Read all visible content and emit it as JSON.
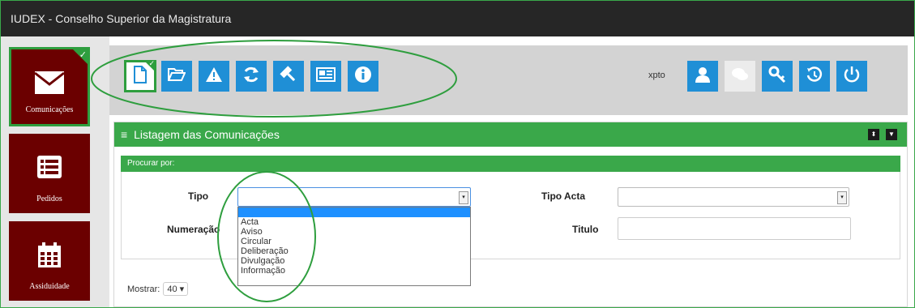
{
  "app": {
    "title": "IUDEX - Conselho Superior da Magistratura"
  },
  "sidebar": {
    "items": [
      {
        "label": "Comunicações",
        "icon": "envelope-icon",
        "active": true
      },
      {
        "label": "Pedidos",
        "icon": "list-icon",
        "active": false
      },
      {
        "label": "Assiduidade",
        "icon": "calendar-icon",
        "active": false
      }
    ]
  },
  "toolbar": {
    "left_buttons": [
      "new-document-icon",
      "folder-open-icon",
      "warning-icon",
      "refresh-icon",
      "gavel-icon",
      "newspaper-icon",
      "info-icon"
    ],
    "user": "xpto",
    "right_buttons": [
      "user-icon",
      "comments-icon",
      "key-icon",
      "history-icon",
      "power-icon"
    ]
  },
  "panel": {
    "title": "Listagem das Comunicações",
    "menu_glyph": "≡",
    "search": {
      "header": "Procurar por:",
      "fields": {
        "tipo": {
          "label": "Tipo",
          "value": ""
        },
        "tipo_acta": {
          "label": "Tipo Acta",
          "value": ""
        },
        "numeracao": {
          "label": "Numeração",
          "value": ""
        },
        "titulo": {
          "label": "Titulo",
          "value": ""
        }
      },
      "tipo_options": [
        "Acta",
        "Aviso",
        "Circular",
        "Deliberação",
        "Divulgação",
        "Informação"
      ]
    },
    "show": {
      "label": "Mostrar:",
      "value": "40"
    }
  },
  "colors": {
    "accent_green": "#3aa84a",
    "button_blue": "#1f8fd6",
    "sidebar_red": "#6b0000",
    "titlebar": "#262626"
  }
}
